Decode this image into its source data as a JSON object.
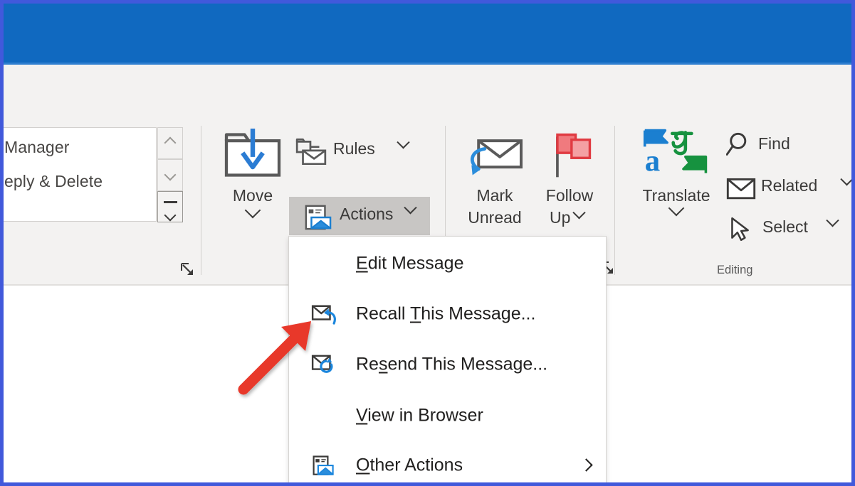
{
  "window": {
    "title_bar_color": "#1069c0",
    "ribbon_bg_color": "#f3f2f1",
    "border_color": "#4159db",
    "highlight_color": "#c8c6c4",
    "accent_blue": "#1b7fd0",
    "annotation_arrow_color": "#e8392c"
  },
  "ribbon": {
    "quick_steps_group": {
      "gallery_items": [
        {
          "label": "Manager",
          "icon": "manager-quickstep-icon"
        },
        {
          "label": "eply & Delete",
          "icon": "reply-delete-quickstep-icon"
        }
      ],
      "scroll_up": "scroll-up-icon",
      "scroll_down": "scroll-down-icon",
      "scroll_more": "more-icon",
      "dialog_launcher": "dialog-launcher-icon"
    },
    "move_group": {
      "move": {
        "label": "Move",
        "icon": "move-folder-icon",
        "has_dropdown": true
      },
      "rules": {
        "label": "Rules",
        "icon": "rules-icon",
        "has_dropdown": true
      },
      "actions": {
        "label": "Actions",
        "icon": "actions-icon",
        "has_dropdown": true,
        "state": "pressed"
      }
    },
    "tags_group": {
      "mark_unread": {
        "label_line1": "Mark",
        "label_line2": "Unread",
        "icon": "mark-unread-icon"
      },
      "follow_up": {
        "label_line1": "Follow",
        "label_line2": "Up",
        "icon": "follow-up-flag-icon",
        "has_dropdown": true
      },
      "dialog_launcher": "dialog-launcher-icon"
    },
    "editing_group": {
      "group_label": "Editing",
      "translate": {
        "label": "Translate",
        "icon": "translate-icon",
        "has_dropdown": true
      },
      "find": {
        "label": "Find",
        "icon": "search-icon"
      },
      "related": {
        "label": "Related",
        "icon": "related-envelope-icon",
        "has_dropdown": true
      },
      "select": {
        "label": "Select",
        "icon": "select-cursor-icon",
        "has_dropdown": true
      }
    }
  },
  "actions_menu": {
    "items": [
      {
        "id": "edit-message",
        "label_pre": "",
        "label_key": "E",
        "label_post": "dit Message",
        "icon": null,
        "has_submenu": false
      },
      {
        "id": "recall-message",
        "label_pre": "Recall ",
        "label_key": "T",
        "label_post": "his Message...",
        "icon": "recall-message-icon",
        "has_submenu": false
      },
      {
        "id": "resend-message",
        "label_pre": "Re",
        "label_key": "s",
        "label_post": "end This Message...",
        "icon": "resend-message-icon",
        "has_submenu": false
      },
      {
        "id": "view-in-browser",
        "label_pre": "",
        "label_key": "V",
        "label_post": "iew in Browser",
        "icon": null,
        "has_submenu": false
      },
      {
        "id": "other-actions",
        "label_pre": "",
        "label_key": "O",
        "label_post": "ther Actions",
        "icon": "other-actions-icon",
        "has_submenu": true
      }
    ]
  }
}
